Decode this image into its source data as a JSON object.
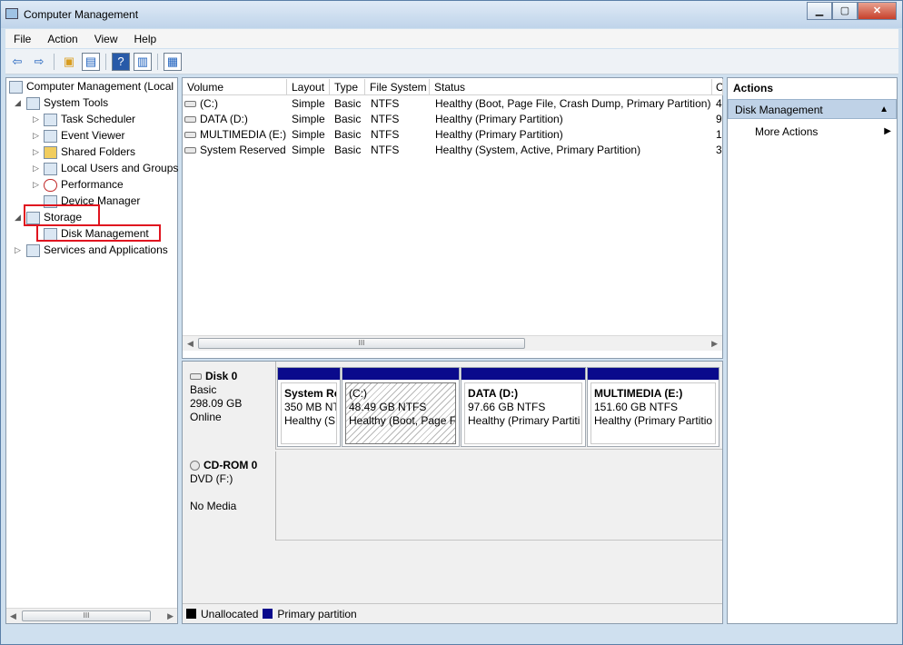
{
  "window": {
    "title": "Computer Management"
  },
  "menu": [
    "File",
    "Action",
    "View",
    "Help"
  ],
  "tree": {
    "root": "Computer Management (Local",
    "system_tools": "System Tools",
    "task_scheduler": "Task Scheduler",
    "event_viewer": "Event Viewer",
    "shared_folders": "Shared Folders",
    "local_users": "Local Users and Groups",
    "performance": "Performance",
    "device_manager": "Device Manager",
    "storage": "Storage",
    "disk_management": "Disk Management",
    "services": "Services and Applications"
  },
  "volumes": {
    "columns": [
      "Volume",
      "Layout",
      "Type",
      "File System",
      "Status",
      "C"
    ],
    "rows": [
      {
        "volume": "(C:)",
        "layout": "Simple",
        "type": "Basic",
        "fs": "NTFS",
        "status": "Healthy (Boot, Page File, Crash Dump, Primary Partition)",
        "c": "4"
      },
      {
        "volume": "DATA (D:)",
        "layout": "Simple",
        "type": "Basic",
        "fs": "NTFS",
        "status": "Healthy (Primary Partition)",
        "c": "9"
      },
      {
        "volume": "MULTIMEDIA (E:)",
        "layout": "Simple",
        "type": "Basic",
        "fs": "NTFS",
        "status": "Healthy (Primary Partition)",
        "c": "1"
      },
      {
        "volume": "System Reserved",
        "layout": "Simple",
        "type": "Basic",
        "fs": "NTFS",
        "status": "Healthy (System, Active, Primary Partition)",
        "c": "3"
      }
    ]
  },
  "disks": {
    "disk0": {
      "name": "Disk 0",
      "type": "Basic",
      "size": "298.09 GB",
      "state": "Online"
    },
    "partitions": [
      {
        "title": "System Re",
        "size": "350 MB NT",
        "status": "Healthy (S"
      },
      {
        "title": "(C:)",
        "size": "48.49 GB NTFS",
        "status": "Healthy (Boot, Page F"
      },
      {
        "title": "DATA  (D:)",
        "size": "97.66 GB NTFS",
        "status": "Healthy (Primary Partiti"
      },
      {
        "title": "MULTIMEDIA  (E:)",
        "size": "151.60 GB NTFS",
        "status": "Healthy (Primary Partitio"
      }
    ],
    "cdrom": {
      "name": "CD-ROM 0",
      "type": "DVD (F:)",
      "state": "No Media"
    }
  },
  "legend": {
    "unallocated": "Unallocated",
    "primary": "Primary partition",
    "unallocated_color": "#000000",
    "primary_color": "#0a0a8c"
  },
  "actions": {
    "header": "Actions",
    "section": "Disk Management",
    "more": "More Actions"
  },
  "scroll_glyph": "III"
}
